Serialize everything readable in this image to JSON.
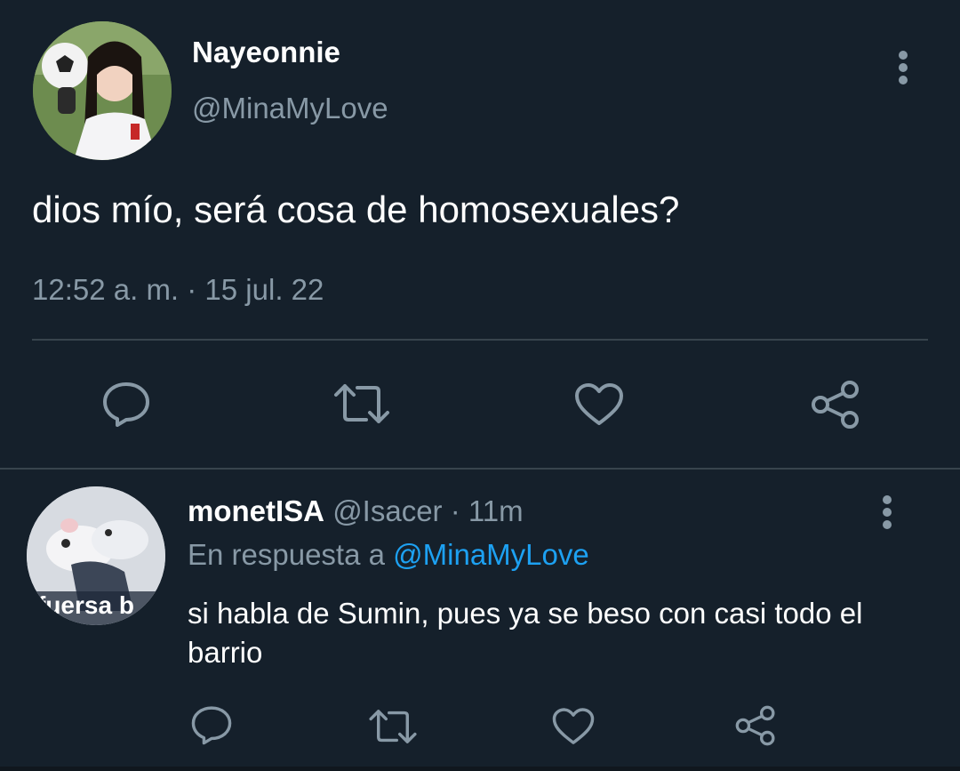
{
  "tweet": {
    "display_name": "Nayeonnie",
    "handle": "@MinaMyLove",
    "text": "dios mío, será cosa de homosexuales?",
    "timestamp": "12:52 a. m. · 15 jul. 22",
    "actions": [
      "reply-icon",
      "retweet-icon",
      "like-icon",
      "share-icon"
    ]
  },
  "reply": {
    "display_name": "monetISA",
    "handle": "@Isacer",
    "separator": " · ",
    "age": "11m",
    "reply_prefix": "En respuesta a ",
    "reply_mention": "@MinaMyLove",
    "avatar_caption": "fuersa b",
    "text": "si habla de Sumin, pues ya se beso con casi todo el barrio",
    "actions": [
      "reply-icon",
      "retweet-icon",
      "like-icon",
      "share-icon"
    ]
  },
  "colors": {
    "background": "#15202b",
    "secondary_text": "#8899a6",
    "link": "#1da1f2",
    "divider": "#38444d"
  }
}
